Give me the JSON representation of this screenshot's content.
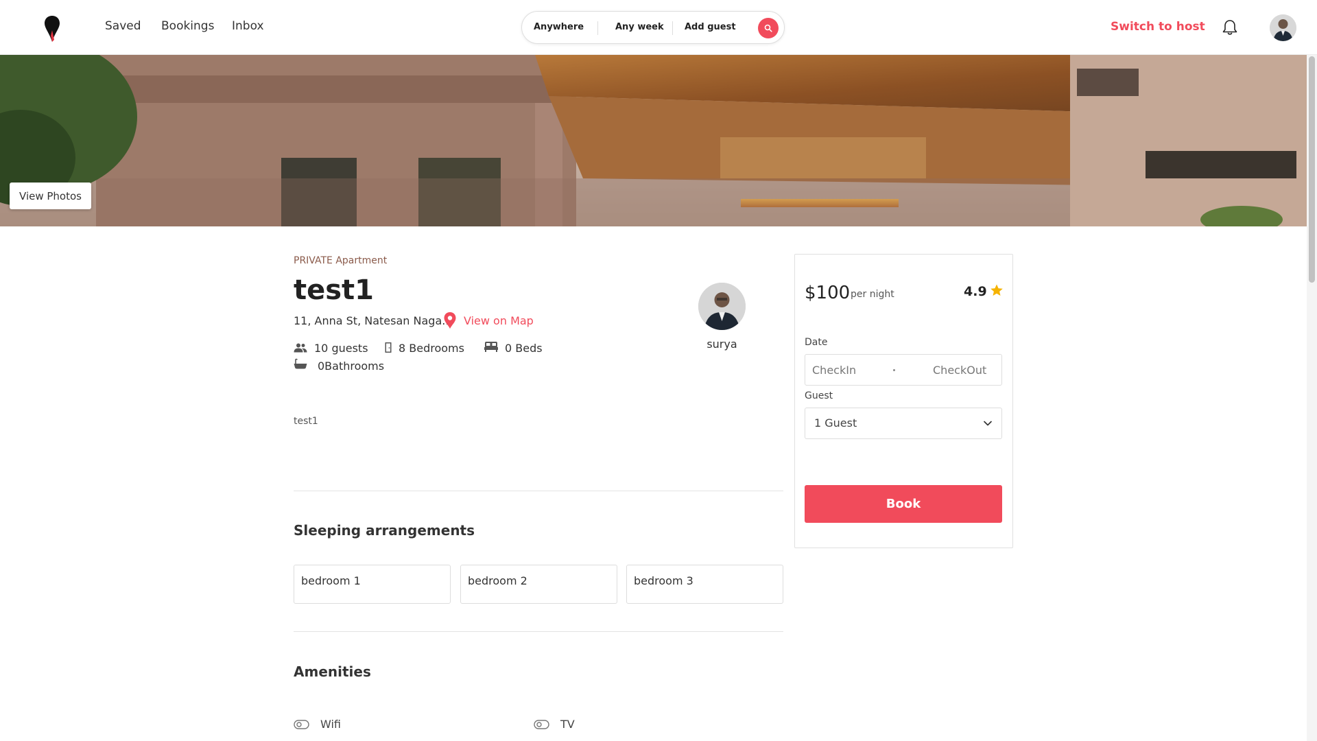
{
  "nav": {
    "saved": "Saved",
    "bookings": "Bookings",
    "inbox": "Inbox",
    "switch_host": "Switch to host"
  },
  "search": {
    "where": "Anywhere",
    "when": "Any week",
    "who": "Add guest"
  },
  "hero": {
    "view_photos": "View Photos"
  },
  "listing": {
    "type": "PRIVATE Apartment",
    "title": "test1",
    "address": "11, Anna St, Natesan Naga...",
    "view_map": "View on Map",
    "guests": "10 guests",
    "bedrooms": "8 Bedrooms",
    "beds": "0 Beds",
    "bathrooms": "0Bathrooms",
    "host_name": "surya",
    "description": "test1"
  },
  "sleeping": {
    "heading": "Sleeping arrangements",
    "rooms": [
      "bedroom 1",
      "bedroom 2",
      "bedroom 3"
    ]
  },
  "amenities": {
    "heading": "Amenities",
    "items": [
      "Wifi",
      "TV"
    ]
  },
  "booking": {
    "price": "$100",
    "per_night": "per night",
    "rating": "4.9",
    "date_label": "Date",
    "checkin_placeholder": "CheckIn",
    "checkout_placeholder": "CheckOut",
    "guest_label": "Guest",
    "guest_value": "1 Guest",
    "book_label": "Book"
  },
  "colors": {
    "accent": "#f14b5b",
    "star": "#f5b301"
  },
  "icons": {
    "logo": "location-pin-logo",
    "search": "search-icon",
    "bell": "bell-icon",
    "pin": "map-pin-icon",
    "guests": "people-icon",
    "bedrooms": "door-icon",
    "beds": "bed-icon",
    "bathrooms": "bathtub-icon",
    "star": "star-icon",
    "chevron": "chevron-down-icon",
    "amenity": "amenity-icon"
  }
}
